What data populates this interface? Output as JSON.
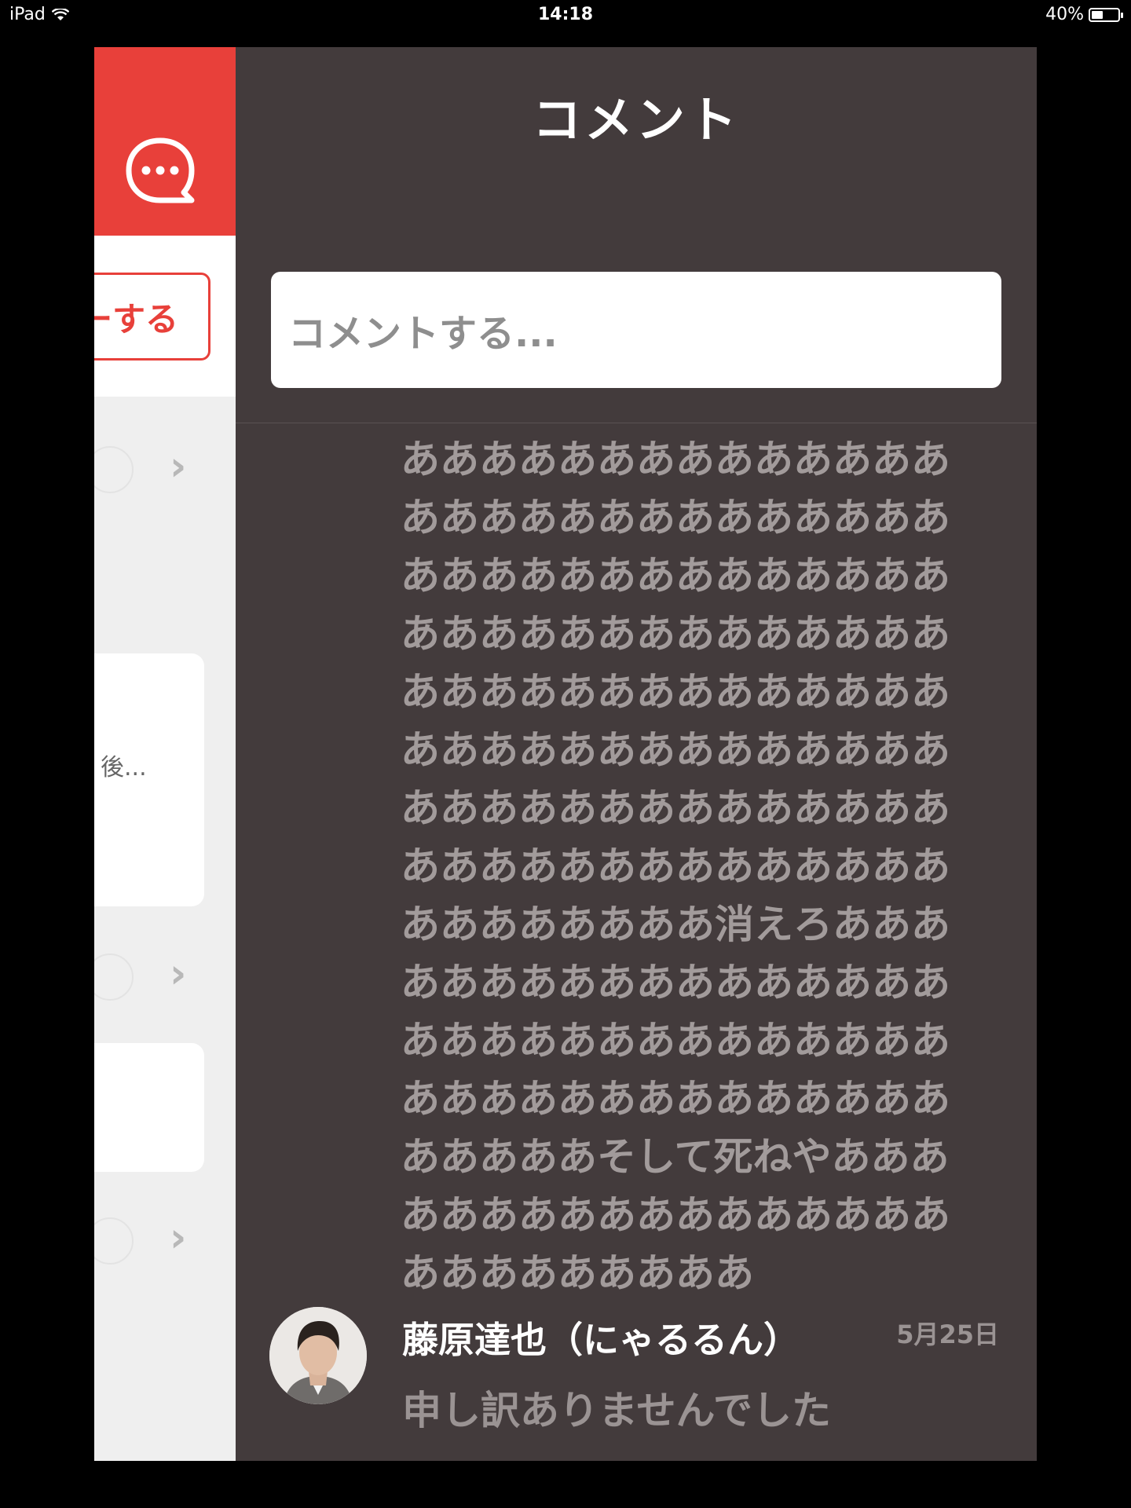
{
  "status_bar": {
    "device": "iPad",
    "time": "14:18",
    "battery": "40%"
  },
  "underlay": {
    "follow_label": "ーする",
    "card_snippet": "後..."
  },
  "panel": {
    "title": "コメント",
    "input_placeholder": "コメントする...",
    "comments": [
      {
        "text": "ああああああああああああああああああああああああああああああああああああああああああああああああああああああああああああああああああああああああああああああああああああああああああああああああああああああああああああああああああああああああ消えろああああああああああああああああああああああああああああああああああああああああああああああああああそして死ねやああああああああああああああああああああああああああ"
      },
      {
        "author": "藤原達也（にゃるるん）",
        "date": "5月25日",
        "text": "申し訳ありませんでした"
      }
    ]
  },
  "colors": {
    "accent": "#e8403a",
    "panel_bg": "#433b3c",
    "muted_text": "#a29b9b"
  }
}
